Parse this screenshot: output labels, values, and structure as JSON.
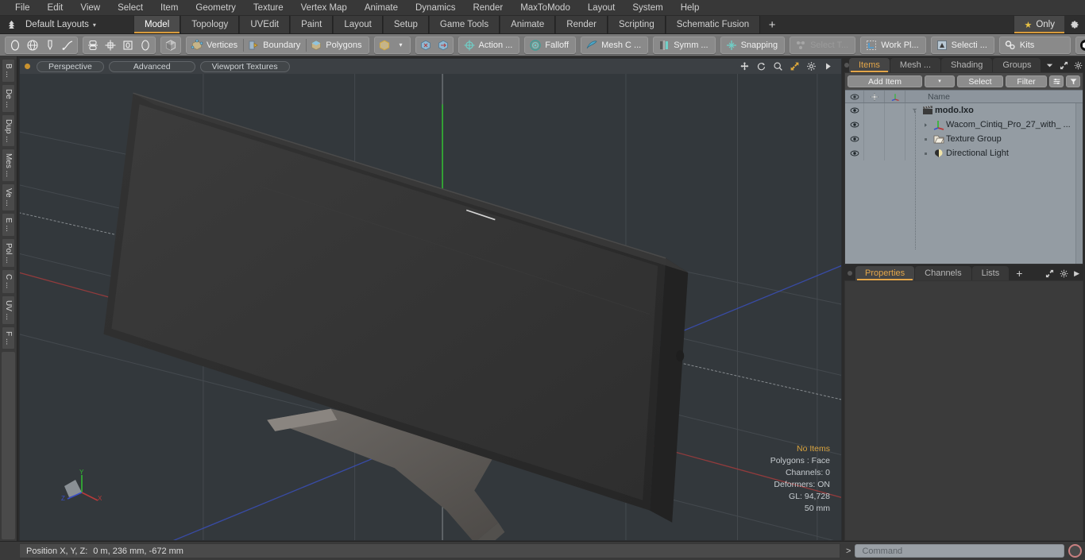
{
  "menubar": {
    "items": [
      "File",
      "Edit",
      "View",
      "Select",
      "Item",
      "Geometry",
      "Texture",
      "Vertex Map",
      "Animate",
      "Dynamics",
      "Render",
      "MaxToModo",
      "Layout",
      "System",
      "Help"
    ]
  },
  "layoutbar": {
    "home_icon": "home-tree-icon",
    "layout_selector": "Default Layouts",
    "caret": "▾",
    "tabs": [
      {
        "label": "Model",
        "active": true
      },
      {
        "label": "Topology",
        "active": false
      },
      {
        "label": "UVEdit",
        "active": false
      },
      {
        "label": "Paint",
        "active": false
      },
      {
        "label": "Layout",
        "active": false
      },
      {
        "label": "Setup",
        "active": false
      },
      {
        "label": "Game Tools",
        "active": false
      },
      {
        "label": "Animate",
        "active": false
      },
      {
        "label": "Render",
        "active": false
      },
      {
        "label": "Scripting",
        "active": false
      },
      {
        "label": "Schematic Fusion",
        "active": false
      }
    ],
    "add_tab": "+",
    "only_label": "Only",
    "only_star": "★",
    "gear_icon": "gear-icon"
  },
  "toolbar": {
    "primitives": [
      "circle-icon",
      "globe-icon",
      "pen-icon",
      "curve-icon"
    ],
    "mesh_ops": [
      "stack-icon",
      "crosshair-box-icon",
      "square-dot-icon",
      "ellipse-icon"
    ],
    "shade_icon": "cube-shade-icon",
    "selection_modes": [
      {
        "label": "Vertices",
        "icon": "vertices-icon"
      },
      {
        "label": "Boundary",
        "icon": "boundary-icon"
      },
      {
        "label": "Polygons",
        "icon": "polygons-icon"
      }
    ],
    "item_mode_icon": "item-cube-icon",
    "item_mode_caret": "▾",
    "paint_icons": [
      "select-through-icon",
      "select-back-icon"
    ],
    "action_center": {
      "label": "Action  ...",
      "icon": "action-center-icon"
    },
    "falloff": {
      "label": "Falloff",
      "icon": "falloff-icon"
    },
    "mesh_constraint": {
      "label": "Mesh C ...",
      "icon": "mesh-constraint-icon"
    },
    "symmetry": {
      "label": "Symm ...",
      "icon": "symmetry-icon"
    },
    "snapping": {
      "label": "Snapping",
      "icon": "snapping-icon"
    },
    "select_through": {
      "label": "Select T...",
      "icon": "select-through-icon",
      "disabled": true
    },
    "work_plane": {
      "label": "Work Pl...",
      "icon": "work-plane-icon"
    },
    "selection_set": {
      "label": "Selecti ...",
      "icon": "selection-icon"
    },
    "kits": {
      "label": "Kits",
      "icon": "kits-gears-icon"
    },
    "logos": [
      "marmoset-cube-logo",
      "unreal-engine-logo"
    ]
  },
  "left_rail": {
    "tabs": [
      "B ...",
      "De ...",
      "Dup ...",
      "Mes ...",
      "Ve ...",
      "E ...",
      "Pol ...",
      "C ...",
      "UV ...",
      "F ..."
    ]
  },
  "viewport": {
    "header": {
      "dot": "viewport-active-dot",
      "pills": [
        "Perspective",
        "Advanced",
        "Viewport Textures"
      ],
      "icons": [
        "move-icon",
        "rotate-icon",
        "zoom-icon",
        "fit-icon",
        "gear-icon",
        "arrow-right-icon"
      ]
    },
    "stats": [
      {
        "text": "No Items",
        "highlight": true
      },
      {
        "text": "Polygons : Face",
        "highlight": false
      },
      {
        "text": "Channels: 0",
        "highlight": false
      },
      {
        "text": "Deformers: ON",
        "highlight": false
      },
      {
        "text": "GL: 94,728",
        "highlight": false
      },
      {
        "text": "50 mm",
        "highlight": false
      }
    ],
    "gizmo": {
      "x": "X",
      "y": "Y",
      "z": "Z",
      "x_color": "#b83a3a",
      "y_color": "#3aa83a",
      "z_color": "#3a4fc8"
    },
    "grid_color": "#3f4448",
    "background": "#33383c",
    "model_name": "Wacom Cintiq Pro 27 tablet on stand"
  },
  "right_panel": {
    "top_tabs": [
      {
        "label": "Items",
        "active": true
      },
      {
        "label": "Mesh ...",
        "active": false
      },
      {
        "label": "Shading",
        "active": false
      },
      {
        "label": "Groups",
        "active": false
      }
    ],
    "top_tabs_icons": [
      "chevron-down-icon",
      "expand-icon",
      "gear-icon",
      "arrow-right-icon"
    ],
    "item_tools": {
      "add_item": "Add Item",
      "add_item_caret": "▾",
      "select": "Select",
      "filter": "Filter",
      "list_icon": "list-options-icon",
      "funnel_icon": "funnel-icon"
    },
    "columns": {
      "eye": "eye-icon",
      "lock": "plus-icon",
      "axis": "axis-icon",
      "name": "Name"
    },
    "items": [
      {
        "name": "modo.lxo",
        "icon": "scene-clapper-icon",
        "bold": true,
        "depth": 0,
        "expander": "funnel"
      },
      {
        "name": "Wacom_Cintiq_Pro_27_with_ ...",
        "icon": "mesh-axis-icon",
        "bold": false,
        "depth": 1,
        "expander": "triangle"
      },
      {
        "name": "Texture Group",
        "icon": "texture-group-icon",
        "bold": false,
        "depth": 1,
        "expander": "dot"
      },
      {
        "name": "Directional Light",
        "icon": "directional-light-icon",
        "bold": false,
        "depth": 1,
        "expander": "dot"
      }
    ],
    "bottom_tabs": [
      {
        "label": "Properties",
        "active": true
      },
      {
        "label": "Channels",
        "active": false
      },
      {
        "label": "Lists",
        "active": false
      },
      {
        "label": "+",
        "active": false
      }
    ],
    "bottom_tabs_icons": [
      "expand-icon",
      "gear-icon",
      "arrow-right-icon"
    ]
  },
  "footer": {
    "position_label": "Position X, Y, Z:",
    "position_value": "0 m, 236 mm, -672 mm",
    "command_prompt": ">",
    "command_placeholder": "Command",
    "record_icon": "record-icon"
  },
  "colors": {
    "accent": "#d79b3c",
    "tab_active_text": "#e3a64a",
    "toolbar_bg": "#787878",
    "panel_bg": "#2b2b2b",
    "list_bg": "#949ca3",
    "viewport_bg": "#33383c"
  }
}
